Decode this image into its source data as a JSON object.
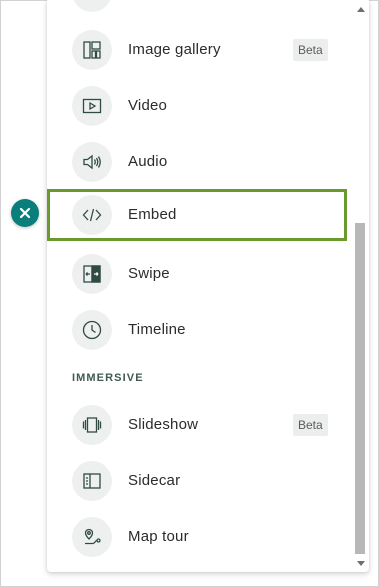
{
  "menu": {
    "items": [
      {
        "label": "Image gallery",
        "icon": "image-gallery-icon",
        "badge": "Beta"
      },
      {
        "label": "Video",
        "icon": "video-icon",
        "badge": ""
      },
      {
        "label": "Audio",
        "icon": "audio-icon",
        "badge": ""
      },
      {
        "label": "Embed",
        "icon": "embed-icon",
        "badge": "",
        "selected": true
      },
      {
        "label": "Swipe",
        "icon": "swipe-icon",
        "badge": ""
      },
      {
        "label": "Timeline",
        "icon": "timeline-icon",
        "badge": ""
      }
    ],
    "immersive_header": "IMMERSIVE",
    "immersive_items": [
      {
        "label": "Slideshow",
        "icon": "slideshow-icon",
        "badge": "Beta"
      },
      {
        "label": "Sidecar",
        "icon": "sidecar-icon",
        "badge": ""
      },
      {
        "label": "Map tour",
        "icon": "map-tour-icon",
        "badge": ""
      }
    ]
  },
  "colors": {
    "selection_border": "#6a9a2e",
    "close_button": "#0a7e7a",
    "icon_circle": "#eef0f0",
    "icon_stroke": "#2f4b44"
  }
}
